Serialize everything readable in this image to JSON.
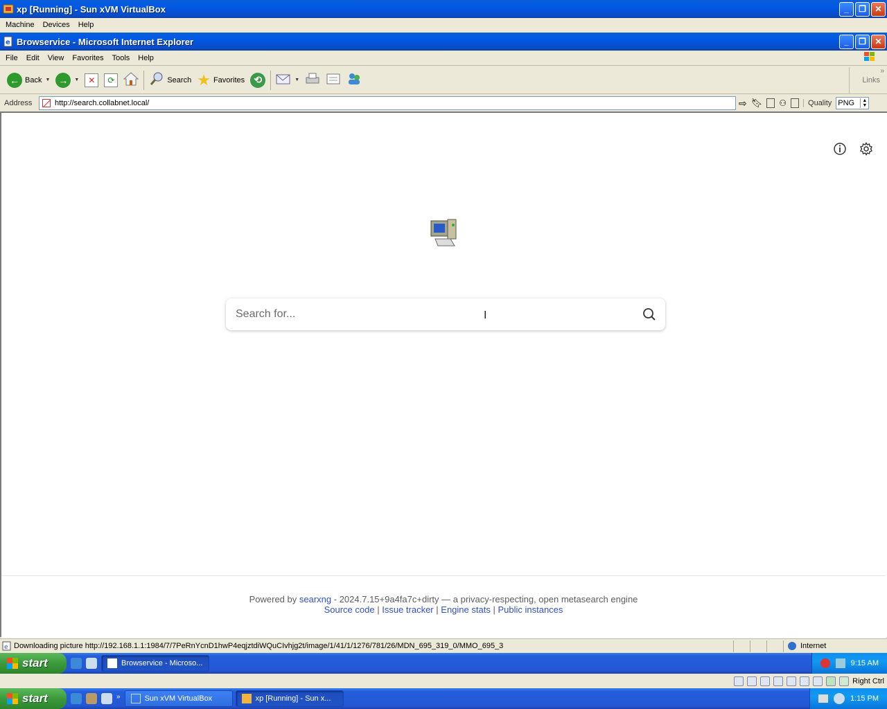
{
  "vbox": {
    "title": "xp [Running] - Sun xVM VirtualBox",
    "menu": [
      "Machine",
      "Devices",
      "Help"
    ]
  },
  "ie": {
    "title": "Browservice - Microsoft Internet Explorer",
    "menu": [
      "File",
      "Edit",
      "View",
      "Favorites",
      "Tools",
      "Help"
    ],
    "toolbar": {
      "back_label": "Back",
      "search_label": "Search",
      "favorites_label": "Favorites",
      "links_label": "Links"
    },
    "address": {
      "label": "Address",
      "url": "http://search.collabnet.local/",
      "quality_label": "Quality",
      "format_value": "PNG"
    },
    "status": {
      "message": "Downloading picture http://192.168.1.1:1984/7/7PeRnYcnD1hwP4eqjztdiWQuCIvhjg2t/image/1/41/1/1276/781/26/MDN_695_319_0/MMO_695_3",
      "zone": "Internet"
    }
  },
  "page": {
    "search_placeholder": "Search for...",
    "footer": {
      "powered_by": "Powered by",
      "searxng_link": "searxng",
      "version_text": "- 2024.7.15+9a4fa7c+dirty — a privacy-respecting, open metasearch engine",
      "links": [
        "Source code",
        "Issue tracker",
        "Engine stats",
        "Public instances"
      ],
      "separator": "|"
    }
  },
  "guest_taskbar": {
    "start_label": "start",
    "task": "Browservice - Microso...",
    "clock": "9:15 AM"
  },
  "host_taskbar": {
    "start_label": "start",
    "tasks": [
      "Sun xVM VirtualBox",
      "xp [Running] - Sun x..."
    ],
    "host_key": "Right Ctrl",
    "clock": "1:15 PM"
  },
  "colors": {
    "xp_blue": "#0058e6",
    "start_green": "#3c9a3c",
    "link_blue": "#3050c8"
  }
}
